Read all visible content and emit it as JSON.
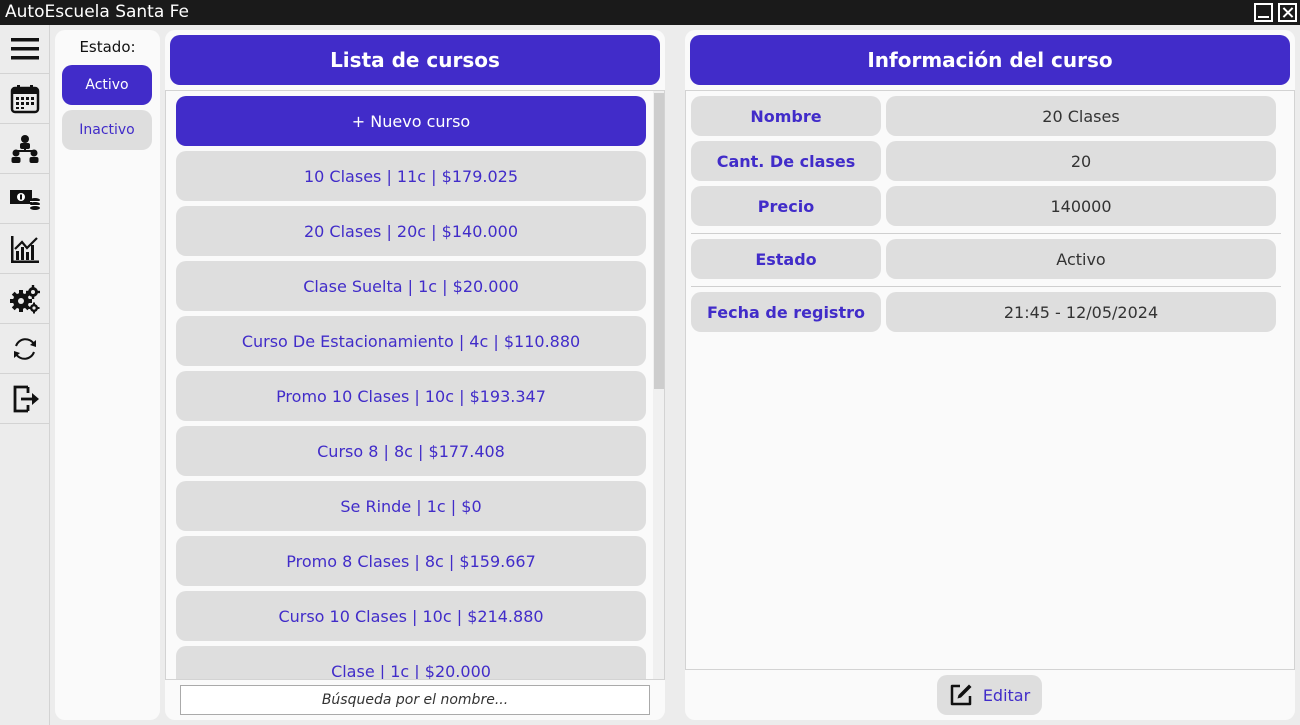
{
  "window": {
    "title": "AutoEscuela Santa Fe"
  },
  "sidebar": {
    "items": [
      {
        "icon": "menu-icon"
      },
      {
        "icon": "calendar-icon"
      },
      {
        "icon": "hierarchy-icon"
      },
      {
        "icon": "money-icon"
      },
      {
        "icon": "chart-icon"
      },
      {
        "icon": "gears-icon"
      },
      {
        "icon": "sync-icon"
      },
      {
        "icon": "logout-icon"
      }
    ]
  },
  "filter": {
    "label": "Estado:",
    "active_label": "Activo",
    "inactive_label": "Inactivo",
    "selected": "Activo"
  },
  "course_list": {
    "header": "Lista de cursos",
    "new_label": "+ Nuevo curso",
    "items": [
      "10 Clases | 11c | $179.025",
      "20 Clases | 20c | $140.000",
      "Clase Suelta | 1c | $20.000",
      "Curso De Estacionamiento | 4c | $110.880",
      "Promo 10 Clases | 10c | $193.347",
      "Curso 8 | 8c | $177.408",
      "Se Rinde | 1c | $0",
      "Promo 8 Clases | 8c | $159.667",
      "Curso 10 Clases | 10c | $214.880",
      "Clase | 1c | $20.000"
    ],
    "search_placeholder": "Búsqueda por el nombre..."
  },
  "info": {
    "header": "Información del curso",
    "rows": [
      {
        "label": "Nombre",
        "value": "20 Clases"
      },
      {
        "label": "Cant. De clases",
        "value": "20"
      },
      {
        "label": "Precio",
        "value": "140000"
      },
      {
        "label": "Estado",
        "value": "Activo"
      },
      {
        "label": "Fecha de registro",
        "value": "21:45 - 12/05/2024"
      }
    ],
    "edit_label": "Editar"
  },
  "colors": {
    "accent": "#412cc9",
    "item_bg": "#dedede",
    "panel_bg": "#fafafa",
    "titlebar": "#1a1a1a"
  }
}
